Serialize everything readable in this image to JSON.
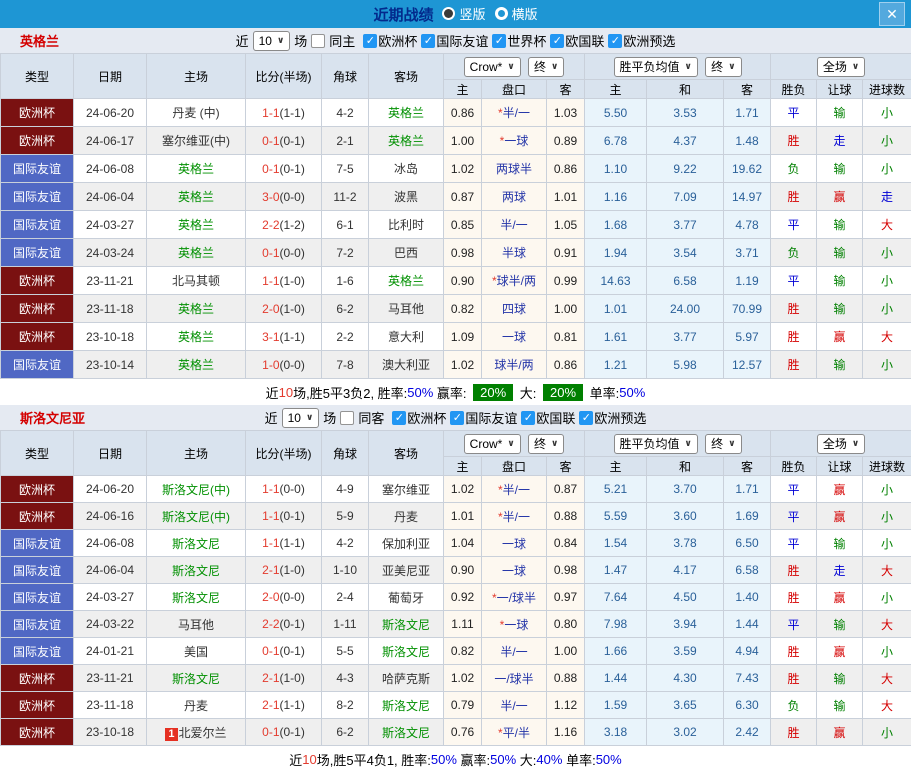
{
  "titlebar": {
    "title": "近期战绩",
    "options": [
      {
        "label": "竖版",
        "selected": true
      },
      {
        "label": "横版",
        "selected": false
      }
    ],
    "close_icon": "✕"
  },
  "colors": {
    "titlebar_bg": "#1E96D4",
    "cup_type_bg": "#7A1111",
    "friendly_type_bg": "#5068C4",
    "header_bg": "#D9E3EE",
    "handicap_cols_bg": "#FDF8F0",
    "euro_cols_bg": "#E9F4FB",
    "win_red": "#D50000",
    "draw_blue": "#0000D5",
    "lose_green": "#008000",
    "chip_green": "#008000"
  },
  "table_header": {
    "cols": [
      "类型",
      "日期",
      "主场",
      "比分(半场)",
      "角球",
      "客场"
    ],
    "sub": [
      "主",
      "盘口",
      "客",
      "主",
      "和",
      "客",
      "胜负",
      "让球",
      "进球数"
    ],
    "dropdowns": {
      "company": "Crow*",
      "final_a": "终",
      "avg": "胜平负均值",
      "final_b": "终",
      "scope": "全场"
    }
  },
  "sections": [
    {
      "team": "英格兰",
      "filter": {
        "prefix": "近",
        "count": "10",
        "suffix": "场",
        "same": {
          "label": "同主",
          "checked": false
        },
        "leagues": [
          {
            "label": "欧洲杯",
            "checked": true
          },
          {
            "label": "国际友谊",
            "checked": true
          },
          {
            "label": "世界杯",
            "checked": true
          },
          {
            "label": "欧国联",
            "checked": true
          },
          {
            "label": "欧洲预选",
            "checked": true
          }
        ]
      },
      "rows": [
        {
          "type": "欧洲杯",
          "tc": "cup",
          "date": "24-06-20",
          "home": "丹麦 (中)",
          "hg": false,
          "score": "1-1",
          "half": "(1-1)",
          "corner": "4-2",
          "away": "英格兰",
          "ag": true,
          "ho": "0.86",
          "star": true,
          "hcap": "半/一",
          "ao": "1.03",
          "eh": "5.50",
          "ed": "3.53",
          "ea": "1.71",
          "r1": "平",
          "r2": "输",
          "r3": "小"
        },
        {
          "type": "欧洲杯",
          "tc": "cup",
          "date": "24-06-17",
          "home": "塞尔维亚(中)",
          "hg": false,
          "score": "0-1",
          "half": "(0-1)",
          "corner": "2-1",
          "away": "英格兰",
          "ag": true,
          "ho": "1.00",
          "star": true,
          "hcap": "一球",
          "ao": "0.89",
          "eh": "6.78",
          "ed": "4.37",
          "ea": "1.48",
          "r1": "胜",
          "r2": "走",
          "r3": "小"
        },
        {
          "type": "国际友谊",
          "tc": "fr",
          "date": "24-06-08",
          "home": "英格兰",
          "hg": true,
          "score": "0-1",
          "half": "(0-1)",
          "corner": "7-5",
          "away": "冰岛",
          "ag": false,
          "ho": "1.02",
          "star": false,
          "hcap": "两球半",
          "ao": "0.86",
          "eh": "1.10",
          "ed": "9.22",
          "ea": "19.62",
          "r1": "负",
          "r2": "输",
          "r3": "小"
        },
        {
          "type": "国际友谊",
          "tc": "fr",
          "date": "24-06-04",
          "home": "英格兰",
          "hg": true,
          "score": "3-0",
          "half": "(0-0)",
          "corner": "11-2",
          "away": "波黑",
          "ag": false,
          "ho": "0.87",
          "star": false,
          "hcap": "两球",
          "ao": "1.01",
          "eh": "1.16",
          "ed": "7.09",
          "ea": "14.97",
          "r1": "胜",
          "r2": "赢",
          "r3": "走"
        },
        {
          "type": "国际友谊",
          "tc": "fr",
          "date": "24-03-27",
          "home": "英格兰",
          "hg": true,
          "score": "2-2",
          "half": "(1-2)",
          "corner": "6-1",
          "away": "比利时",
          "ag": false,
          "ho": "0.85",
          "star": false,
          "hcap": "半/一",
          "ao": "1.05",
          "eh": "1.68",
          "ed": "3.77",
          "ea": "4.78",
          "r1": "平",
          "r2": "输",
          "r3": "大"
        },
        {
          "type": "国际友谊",
          "tc": "fr",
          "date": "24-03-24",
          "home": "英格兰",
          "hg": true,
          "score": "0-1",
          "half": "(0-0)",
          "corner": "7-2",
          "away": "巴西",
          "ag": false,
          "ho": "0.98",
          "star": false,
          "hcap": "半球",
          "ao": "0.91",
          "eh": "1.94",
          "ed": "3.54",
          "ea": "3.71",
          "r1": "负",
          "r2": "输",
          "r3": "小"
        },
        {
          "type": "欧洲杯",
          "tc": "cup",
          "date": "23-11-21",
          "home": "北马其顿",
          "hg": false,
          "score": "1-1",
          "half": "(1-0)",
          "corner": "1-6",
          "away": "英格兰",
          "ag": true,
          "ho": "0.90",
          "star": true,
          "hcap": "球半/两",
          "ao": "0.99",
          "eh": "14.63",
          "ed": "6.58",
          "ea": "1.19",
          "r1": "平",
          "r2": "输",
          "r3": "小"
        },
        {
          "type": "欧洲杯",
          "tc": "cup",
          "date": "23-11-18",
          "home": "英格兰",
          "hg": true,
          "score": "2-0",
          "half": "(1-0)",
          "corner": "6-2",
          "away": "马耳他",
          "ag": false,
          "ho": "0.82",
          "star": false,
          "hcap": "四球",
          "ao": "1.00",
          "eh": "1.01",
          "ed": "24.00",
          "ea": "70.99",
          "r1": "胜",
          "r2": "输",
          "r3": "小"
        },
        {
          "type": "欧洲杯",
          "tc": "cup",
          "date": "23-10-18",
          "home": "英格兰",
          "hg": true,
          "score": "3-1",
          "half": "(1-1)",
          "corner": "2-2",
          "away": "意大利",
          "ag": false,
          "ho": "1.09",
          "star": false,
          "hcap": "一球",
          "ao": "0.81",
          "eh": "1.61",
          "ed": "3.77",
          "ea": "5.97",
          "r1": "胜",
          "r2": "赢",
          "r3": "大"
        },
        {
          "type": "国际友谊",
          "tc": "fr",
          "date": "23-10-14",
          "home": "英格兰",
          "hg": true,
          "score": "1-0",
          "half": "(0-0)",
          "corner": "7-8",
          "away": "澳大利亚",
          "ag": false,
          "ho": "1.02",
          "star": false,
          "hcap": "球半/两",
          "ao": "0.86",
          "eh": "1.21",
          "ed": "5.98",
          "ea": "12.57",
          "r1": "胜",
          "r2": "输",
          "r3": "小"
        }
      ],
      "summary": [
        {
          "t": "近",
          "c": "black"
        },
        {
          "t": "10",
          "c": "red-inline"
        },
        {
          "t": "场,胜5平3负2, 胜率:",
          "c": "black"
        },
        {
          "t": "50%",
          "c": "blue"
        },
        {
          "t": " 赢率: ",
          "c": "black"
        },
        {
          "t": "20%",
          "c": "chip"
        },
        {
          "t": " 大: ",
          "c": "black"
        },
        {
          "t": "20%",
          "c": "chip"
        },
        {
          "t": " 单率:",
          "c": "black"
        },
        {
          "t": "50%",
          "c": "blue"
        }
      ]
    },
    {
      "team": "斯洛文尼亚",
      "filter": {
        "prefix": "近",
        "count": "10",
        "suffix": "场",
        "same": {
          "label": "同客",
          "checked": false
        },
        "leagues": [
          {
            "label": "欧洲杯",
            "checked": true
          },
          {
            "label": "国际友谊",
            "checked": true
          },
          {
            "label": "欧国联",
            "checked": true
          },
          {
            "label": "欧洲预选",
            "checked": true
          }
        ]
      },
      "rows": [
        {
          "type": "欧洲杯",
          "tc": "cup",
          "date": "24-06-20",
          "home": "斯洛文尼(中)",
          "hg": true,
          "score": "1-1",
          "half": "(0-0)",
          "corner": "4-9",
          "away": "塞尔维亚",
          "ag": false,
          "ho": "1.02",
          "star": true,
          "hcap": "半/一",
          "ao": "0.87",
          "eh": "5.21",
          "ed": "3.70",
          "ea": "1.71",
          "r1": "平",
          "r2": "赢",
          "r3": "小"
        },
        {
          "type": "欧洲杯",
          "tc": "cup",
          "date": "24-06-16",
          "home": "斯洛文尼(中)",
          "hg": true,
          "score": "1-1",
          "half": "(0-1)",
          "corner": "5-9",
          "away": "丹麦",
          "ag": false,
          "ho": "1.01",
          "star": true,
          "hcap": "半/一",
          "ao": "0.88",
          "eh": "5.59",
          "ed": "3.60",
          "ea": "1.69",
          "r1": "平",
          "r2": "赢",
          "r3": "小"
        },
        {
          "type": "国际友谊",
          "tc": "fr",
          "date": "24-06-08",
          "home": "斯洛文尼",
          "hg": true,
          "score": "1-1",
          "half": "(1-1)",
          "corner": "4-2",
          "away": "保加利亚",
          "ag": false,
          "ho": "1.04",
          "star": false,
          "hcap": "一球",
          "ao": "0.84",
          "eh": "1.54",
          "ed": "3.78",
          "ea": "6.50",
          "r1": "平",
          "r2": "输",
          "r3": "小"
        },
        {
          "type": "国际友谊",
          "tc": "fr",
          "date": "24-06-04",
          "home": "斯洛文尼",
          "hg": true,
          "score": "2-1",
          "half": "(1-0)",
          "corner": "1-10",
          "away": "亚美尼亚",
          "ag": false,
          "ho": "0.90",
          "star": false,
          "hcap": "一球",
          "ao": "0.98",
          "eh": "1.47",
          "ed": "4.17",
          "ea": "6.58",
          "r1": "胜",
          "r2": "走",
          "r3": "大"
        },
        {
          "type": "国际友谊",
          "tc": "fr",
          "date": "24-03-27",
          "home": "斯洛文尼",
          "hg": true,
          "score": "2-0",
          "half": "(0-0)",
          "corner": "2-4",
          "away": "葡萄牙",
          "ag": false,
          "ho": "0.92",
          "star": true,
          "hcap": "一/球半",
          "ao": "0.97",
          "eh": "7.64",
          "ed": "4.50",
          "ea": "1.40",
          "r1": "胜",
          "r2": "赢",
          "r3": "小"
        },
        {
          "type": "国际友谊",
          "tc": "fr",
          "date": "24-03-22",
          "home": "马耳他",
          "hg": false,
          "score": "2-2",
          "half": "(0-1)",
          "corner": "1-11",
          "away": "斯洛文尼",
          "ag": true,
          "ho": "1.11",
          "star": true,
          "hcap": "一球",
          "ao": "0.80",
          "eh": "7.98",
          "ed": "3.94",
          "ea": "1.44",
          "r1": "平",
          "r2": "输",
          "r3": "大"
        },
        {
          "type": "国际友谊",
          "tc": "fr",
          "date": "24-01-21",
          "home": "美国",
          "hg": false,
          "score": "0-1",
          "half": "(0-1)",
          "corner": "5-5",
          "away": "斯洛文尼",
          "ag": true,
          "ho": "0.82",
          "star": false,
          "hcap": "半/一",
          "ao": "1.00",
          "eh": "1.66",
          "ed": "3.59",
          "ea": "4.94",
          "r1": "胜",
          "r2": "赢",
          "r3": "小"
        },
        {
          "type": "欧洲杯",
          "tc": "cup",
          "date": "23-11-21",
          "home": "斯洛文尼",
          "hg": true,
          "score": "2-1",
          "half": "(1-0)",
          "corner": "4-3",
          "away": "哈萨克斯",
          "ag": false,
          "ho": "1.02",
          "star": false,
          "hcap": "一/球半",
          "ao": "0.88",
          "eh": "1.44",
          "ed": "4.30",
          "ea": "7.43",
          "r1": "胜",
          "r2": "输",
          "r3": "大"
        },
        {
          "type": "欧洲杯",
          "tc": "cup",
          "date": "23-11-18",
          "home": "丹麦",
          "hg": false,
          "score": "2-1",
          "half": "(1-1)",
          "corner": "8-2",
          "away": "斯洛文尼",
          "ag": true,
          "ho": "0.79",
          "star": false,
          "hcap": "半/一",
          "ao": "1.12",
          "eh": "1.59",
          "ed": "3.65",
          "ea": "6.30",
          "r1": "负",
          "r2": "输",
          "r3": "大"
        },
        {
          "type": "欧洲杯",
          "tc": "cup",
          "date": "23-10-18",
          "home": "北爱尔兰",
          "badge": "1",
          "hg": false,
          "score": "0-1",
          "half": "(0-1)",
          "corner": "6-2",
          "away": "斯洛文尼",
          "ag": true,
          "ho": "0.76",
          "star": true,
          "hcap": "平/半",
          "ao": "1.16",
          "eh": "3.18",
          "ed": "3.02",
          "ea": "2.42",
          "r1": "胜",
          "r2": "赢",
          "r3": "小"
        }
      ],
      "summary": [
        {
          "t": "近",
          "c": "black"
        },
        {
          "t": "10",
          "c": "red-inline"
        },
        {
          "t": "场,胜5平4负1, 胜率:",
          "c": "black"
        },
        {
          "t": "50%",
          "c": "blue"
        },
        {
          "t": " 赢率:",
          "c": "black"
        },
        {
          "t": "50%",
          "c": "blue"
        },
        {
          "t": " 大:",
          "c": "black"
        },
        {
          "t": "40%",
          "c": "blue"
        },
        {
          "t": " 单率:",
          "c": "black"
        },
        {
          "t": "50%",
          "c": "blue"
        }
      ]
    }
  ]
}
